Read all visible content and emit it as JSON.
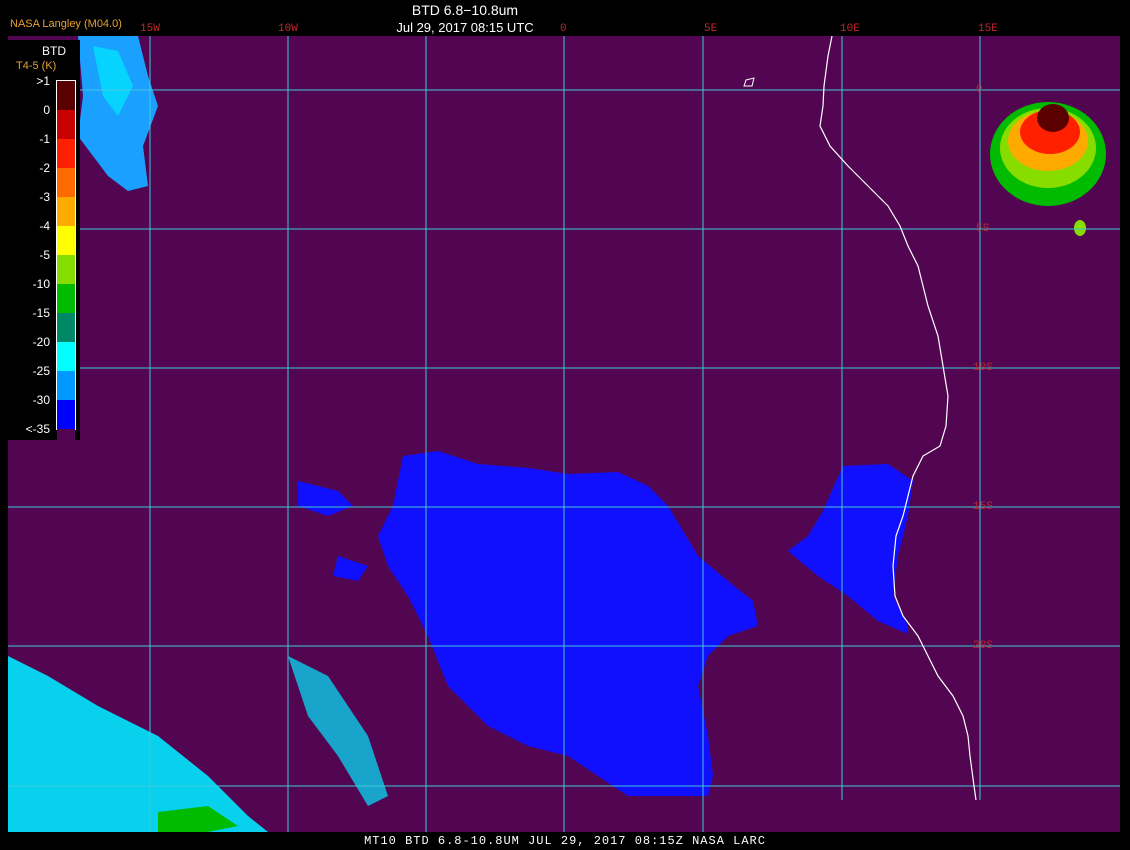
{
  "header": {
    "title": "BTD 6.8−10.8um",
    "subtitle": "Jul 29, 2017 08:15 UTC",
    "credit": "NASA Langley (M04.0)"
  },
  "lon_labels": [
    "15W",
    "10W",
    "0",
    "5E",
    "10E",
    "15E"
  ],
  "lat_labels": [
    "0",
    "5S",
    "10S",
    "15S",
    "20S"
  ],
  "legend": {
    "title": "BTD",
    "unit": "T4-5 (K)",
    "ticks": [
      ">1",
      "0",
      "-1",
      "-2",
      "-3",
      "-4",
      "-5",
      "-10",
      "-15",
      "-20",
      "-25",
      "-30",
      "<-35"
    ],
    "colors": [
      "#5a0000",
      "#c80000",
      "#ff2000",
      "#ff6a00",
      "#ffaa00",
      "#ffff00",
      "#88dd00",
      "#00bb00",
      "#008866",
      "#00ffff",
      "#0099ff",
      "#0000ff",
      "#520652"
    ]
  },
  "footer": {
    "text": "MT10  BTD 6.8-10.8UM  JUL 29, 2017 08:15Z  NASA LARC"
  },
  "colors": {
    "background": "#520652",
    "grid": "#40c8d8",
    "coast": "#ffffff",
    "cloud_blue": "#1010ff",
    "label_red": "#c0282c"
  }
}
